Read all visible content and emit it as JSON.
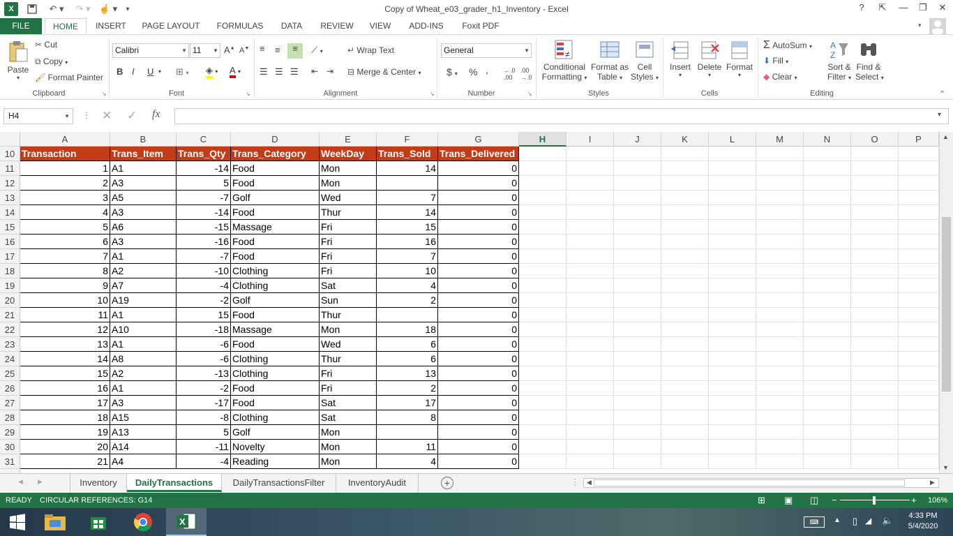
{
  "window": {
    "title": "Copy of Wheat_e03_grader_h1_Inventory - Excel",
    "help": "?",
    "minimize": "—",
    "restore": "❐",
    "close": "✕"
  },
  "ribbon_tabs": [
    "FILE",
    "HOME",
    "INSERT",
    "PAGE LAYOUT",
    "FORMULAS",
    "DATA",
    "REVIEW",
    "VIEW",
    "ADD-INS",
    "Foxit PDF"
  ],
  "clipboard": {
    "paste": "Paste",
    "cut": "Cut",
    "copy": "Copy",
    "format_painter": "Format Painter",
    "label": "Clipboard"
  },
  "font": {
    "name": "Calibri",
    "size": "11",
    "label": "Font",
    "bold": "B",
    "italic": "I",
    "underline": "U"
  },
  "alignment": {
    "wrap": "Wrap Text",
    "merge": "Merge & Center",
    "label": "Alignment"
  },
  "number": {
    "format": "General",
    "label": "Number",
    "currency": "$",
    "percent": "%",
    "comma": ","
  },
  "styles": {
    "conditional": [
      "Conditional",
      "Formatting"
    ],
    "format_table": [
      "Format as",
      "Table"
    ],
    "cell_styles": [
      "Cell",
      "Styles"
    ],
    "label": "Styles"
  },
  "cells": {
    "insert": "Insert",
    "delete": "Delete",
    "format": "Format",
    "label": "Cells"
  },
  "editing": {
    "autosum": "AutoSum",
    "fill": "Fill",
    "clear": "Clear",
    "sort": [
      "Sort &",
      "Filter"
    ],
    "find": [
      "Find &",
      "Select"
    ],
    "label": "Editing"
  },
  "formula_bar": {
    "name_box": "H4",
    "fx": "fx",
    "value": ""
  },
  "columns": [
    "A",
    "B",
    "C",
    "D",
    "E",
    "F",
    "G",
    "H",
    "I",
    "J",
    "K",
    "L",
    "M",
    "N",
    "O",
    "P"
  ],
  "table": {
    "headers": [
      "Transaction",
      "Trans_Item",
      "Trans_Qty",
      "Trans_Category",
      "WeekDay",
      "Trans_Sold",
      "Trans_Delivered"
    ],
    "rows": [
      {
        "r": "11",
        "v": [
          "1",
          "A1",
          "-14",
          "Food",
          "Mon",
          "14",
          "0"
        ]
      },
      {
        "r": "12",
        "v": [
          "2",
          "A3",
          "5",
          "Food",
          "Mon",
          "",
          "0"
        ]
      },
      {
        "r": "13",
        "v": [
          "3",
          "A5",
          "-7",
          "Golf",
          "Wed",
          "7",
          "0"
        ]
      },
      {
        "r": "14",
        "v": [
          "4",
          "A3",
          "-14",
          "Food",
          "Thur",
          "14",
          "0"
        ]
      },
      {
        "r": "15",
        "v": [
          "5",
          "A6",
          "-15",
          "Massage",
          "Fri",
          "15",
          "0"
        ]
      },
      {
        "r": "16",
        "v": [
          "6",
          "A3",
          "-16",
          "Food",
          "Fri",
          "16",
          "0"
        ]
      },
      {
        "r": "17",
        "v": [
          "7",
          "A1",
          "-7",
          "Food",
          "Fri",
          "7",
          "0"
        ]
      },
      {
        "r": "18",
        "v": [
          "8",
          "A2",
          "-10",
          "Clothing",
          "Fri",
          "10",
          "0"
        ]
      },
      {
        "r": "19",
        "v": [
          "9",
          "A7",
          "-4",
          "Clothing",
          "Sat",
          "4",
          "0"
        ]
      },
      {
        "r": "20",
        "v": [
          "10",
          "A19",
          "-2",
          "Golf",
          "Sun",
          "2",
          "0"
        ]
      },
      {
        "r": "21",
        "v": [
          "11",
          "A1",
          "15",
          "Food",
          "Thur",
          "",
          "0"
        ]
      },
      {
        "r": "22",
        "v": [
          "12",
          "A10",
          "-18",
          "Massage",
          "Mon",
          "18",
          "0"
        ]
      },
      {
        "r": "23",
        "v": [
          "13",
          "A1",
          "-6",
          "Food",
          "Wed",
          "6",
          "0"
        ]
      },
      {
        "r": "24",
        "v": [
          "14",
          "A8",
          "-6",
          "Clothing",
          "Thur",
          "6",
          "0"
        ]
      },
      {
        "r": "25",
        "v": [
          "15",
          "A2",
          "-13",
          "Clothing",
          "Fri",
          "13",
          "0"
        ]
      },
      {
        "r": "26",
        "v": [
          "16",
          "A1",
          "-2",
          "Food",
          "Fri",
          "2",
          "0"
        ]
      },
      {
        "r": "27",
        "v": [
          "17",
          "A3",
          "-17",
          "Food",
          "Sat",
          "17",
          "0"
        ]
      },
      {
        "r": "28",
        "v": [
          "18",
          "A15",
          "-8",
          "Clothing",
          "Sat",
          "8",
          "0"
        ]
      },
      {
        "r": "29",
        "v": [
          "19",
          "A13",
          "5",
          "Golf",
          "Mon",
          "",
          "0"
        ]
      },
      {
        "r": "30",
        "v": [
          "20",
          "A14",
          "-11",
          "Novelty",
          "Mon",
          "11",
          "0"
        ]
      },
      {
        "r": "31",
        "v": [
          "21",
          "A4",
          "-4",
          "Reading",
          "Mon",
          "4",
          "0"
        ]
      }
    ],
    "header_row": "10"
  },
  "sheet_tabs": [
    "Inventory",
    "DailyTransactions",
    "DailyTransactionsFilter",
    "InventoryAudit"
  ],
  "active_sheet": "DailyTransactions",
  "status": {
    "mode": "READY",
    "message": "CIRCULAR REFERENCES: G14",
    "zoom": "106%"
  },
  "taskbar": {
    "time": "4:33 PM",
    "date": "5/4/2020"
  },
  "colors": {
    "excel_green": "#217346",
    "table_header": "#c43b17"
  }
}
